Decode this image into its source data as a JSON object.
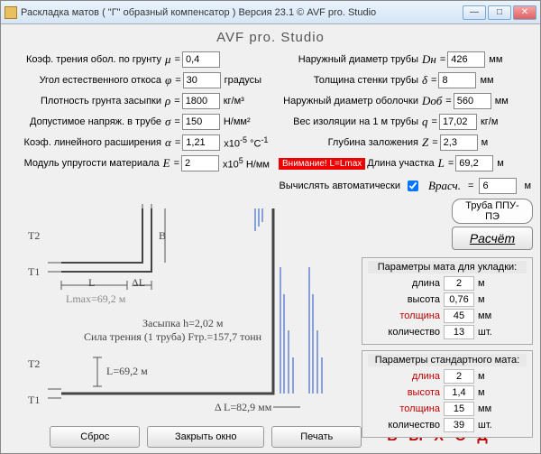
{
  "window": {
    "title": "Раскладка матов ( \"Г\" образный компенсатор )    Версия 23.1   © AVF pro. Studio",
    "appTitle": "AVF pro. Studio"
  },
  "left": {
    "mu": {
      "label": "Коэф. трения обол. по грунту",
      "sym": "μ",
      "val": "0,4",
      "unit": ""
    },
    "phi": {
      "label": "Угол естественного откоса",
      "sym": "φ",
      "val": "30",
      "unit": "градусы"
    },
    "rho": {
      "label": "Плотность грунта засыпки",
      "sym": "ρ",
      "val": "1800",
      "unit": "кг/м³"
    },
    "sigma": {
      "label": "Допустимое напряж. в трубе",
      "sym": "σ",
      "val": "150",
      "unit": "Н/мм²"
    },
    "alpha": {
      "label": "Коэф. линейного расширения",
      "sym": "α",
      "val": "1,21",
      "unit": "x10⁻⁵ °C⁻¹"
    },
    "E": {
      "label": "Модуль упругости материала",
      "sym": "E",
      "val": "2",
      "unit": "x10⁵ Н/мм"
    }
  },
  "right": {
    "Dn": {
      "label": "Наружный диаметр трубы",
      "sym": "Dн",
      "val": "426",
      "unit": "мм"
    },
    "delta": {
      "label": "Толщина стенки трубы",
      "sym": "δ",
      "val": "8",
      "unit": "мм"
    },
    "Dob": {
      "label": "Наружный диаметр оболочки",
      "sym": "Dоб",
      "val": "560",
      "unit": "мм"
    },
    "q": {
      "label": "Вес изоляции на 1 м трубы",
      "sym": "q",
      "val": "17,02",
      "unit": "кг/м"
    },
    "Z": {
      "label": "Глубина заложения",
      "sym": "Z",
      "val": "2,3",
      "unit": "м"
    },
    "L": {
      "warn": "Внимание! L=Lmax",
      "label": "Длина участка",
      "sym": "L",
      "val": "69,2",
      "unit": "м"
    }
  },
  "auto": {
    "label": "Вычислять автоматически",
    "sym": "Врасч.",
    "val": "6",
    "unit": "м"
  },
  "diagram": {
    "T1": "T1",
    "T2": "T2",
    "L": "L",
    "dL": "ΔL",
    "B": "B",
    "Lmax": "Lmax=69,2 м",
    "zasypka": "Засыпка h=2,02 м",
    "friction": "Сила трения (1 труба) Fтр.=157,7 тонн",
    "Lval": "L=69,2 м",
    "dLval": "Δ L=82,9 мм"
  },
  "pill": "Труба ППУ-ПЭ",
  "calcBtn": "Расчёт",
  "matLay": {
    "title": "Параметры мата для укладки:",
    "rows": [
      {
        "lab": "длина",
        "val": "2",
        "unit": "м",
        "red": false
      },
      {
        "lab": "высота",
        "val": "0,76",
        "unit": "м",
        "red": false
      },
      {
        "lab": "толщина",
        "val": "45",
        "unit": "мм",
        "red": true
      },
      {
        "lab": "количество",
        "val": "13",
        "unit": "шт.",
        "red": false
      }
    ]
  },
  "matStd": {
    "title": "Параметры стандартного мата:",
    "rows": [
      {
        "lab": "длина",
        "val": "2",
        "unit": "м",
        "red": true
      },
      {
        "lab": "высота",
        "val": "1,4",
        "unit": "м",
        "red": true
      },
      {
        "lab": "толщина",
        "val": "15",
        "unit": "мм",
        "red": true
      },
      {
        "lab": "количество",
        "val": "39",
        "unit": "шт.",
        "red": false
      }
    ]
  },
  "buttons": {
    "reset": "Сброс",
    "close": "Закрыть окно",
    "print": "Печать",
    "exit": "В Ы Х О Д"
  }
}
